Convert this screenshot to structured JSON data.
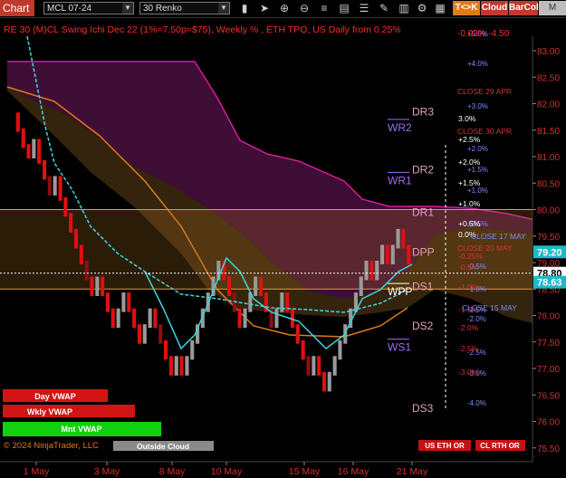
{
  "toolbar": {
    "title": "Chart",
    "instrument": "MCL 07-24",
    "bar_type": "30 Renko",
    "tpo_button": "T<>K",
    "cloud_button": "Cloud",
    "barcol_button": "BarCol",
    "m_button": "M VWA"
  },
  "colors": {
    "bull_bar": "#9a9a9a",
    "bear_bar": "#e01010",
    "dark_bear_bar": "#8a1010",
    "cloud_upper": "#d81b9a",
    "cloud_lower": "#e07b17",
    "vwap_line": "#3fd6e0",
    "range_line": "#e0a030",
    "price_line": "#ffffff",
    "axis_text": "#d63031"
  },
  "header": {
    "line": "RE 30 (M)CL Swing Ichi Dec 22  (1%=7.50p=$75), Weekly % , ETH TPO, US Daily from 0.25%"
  },
  "price_axis": [
    "83.00",
    "82.50",
    "82.00",
    "81.50",
    "81.00",
    "80.50",
    "80.00",
    "79.50",
    "79.00",
    "78.50",
    "78.00",
    "77.50",
    "77.00",
    "76.50",
    "76.00",
    "75.50"
  ],
  "price_badges": {
    "upper": "79.20",
    "current": "78.80",
    "lower": "78.63"
  },
  "date_axis": [
    "1 May",
    "3 May",
    "8 May",
    "10 May",
    "15 May",
    "16 May",
    "21 May"
  ],
  "pivots": {
    "right": [
      "DR3",
      "DR2",
      "DR1",
      "DPP",
      "DS1",
      "DS2",
      "DS3"
    ],
    "weekly": [
      "WR2",
      "WR1",
      "WPP",
      "WS1"
    ]
  },
  "pct_levels": [
    "+5.0%",
    "+4.0%",
    "+3.0%",
    "+2.0%",
    "+1.5%",
    "+1.0%",
    "+0.5%",
    "-0.5%",
    "-1.0%",
    "-1.5%",
    "-2.0%",
    "-2.5%",
    "-3.0%",
    "-4.0%"
  ],
  "ref_labels": {
    "close29": "CLOSE 29 APR",
    "close30": "CLOSE 30 APR",
    "close17": "CLOSE 17 MAY",
    "close20": "CLOSE 20 MAY",
    "close15": "CLOSE 15 MAY",
    "top_pct": "-0.03% -4.50"
  },
  "side_pct": [
    "3.0%",
    "+2.5%",
    "+2.0%",
    "+1.5%",
    "+1.0%",
    "+0.5%",
    "0.0%",
    "-0.25%",
    "-0.5%",
    "-1.0%",
    "-1.5%",
    "-2.0%",
    "-2.5%",
    "-3.0%"
  ],
  "legend_bars": [
    "Day VWAP",
    "Wkly VWAP",
    "Mnt VWAP"
  ],
  "footer": {
    "copyright": "© 2024 NinjaTrader, LLC",
    "outside_cloud": "Outside Cloud",
    "us_eth": "US ETH OR",
    "cl_rth": "CL RTH OR"
  },
  "chart_data": {
    "type": "renko",
    "instrument": "MCL 07-24",
    "ylim": [
      75.3,
      83.2
    ],
    "current_price": 78.8,
    "levels": {
      "DR3": 81.85,
      "DR2": 80.75,
      "DR1": 79.95,
      "DPP": 79.2,
      "DS1": 78.55,
      "DS2": 77.8,
      "DS3": 76.25,
      "WR2": 81.55,
      "WR1": 80.55,
      "WPP": 78.45,
      "WS1": 77.4,
      "range_high": 80.0,
      "range_low": 78.5
    }
  }
}
